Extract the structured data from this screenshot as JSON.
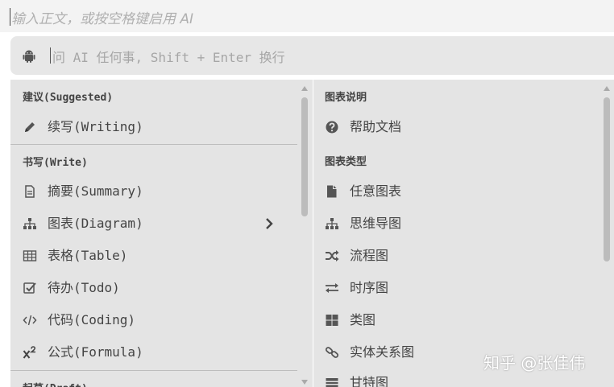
{
  "editor": {
    "placeholder": "输入正文，或按空格键启用 AI"
  },
  "ai_bar": {
    "placeholder": "问 AI 任何事, Shift + Enter 换行",
    "icon": "android-icon"
  },
  "left_menu": {
    "sections": [
      {
        "header": "建议(Suggested)",
        "items": [
          {
            "label": "续写(Writing)",
            "icon": "pencil-icon"
          }
        ]
      },
      {
        "header": "书写(Write)",
        "items": [
          {
            "label": "摘要(Summary)",
            "icon": "document-icon"
          },
          {
            "label": "图表(Diagram)",
            "icon": "sitemap-icon",
            "has_submenu": true
          },
          {
            "label": "表格(Table)",
            "icon": "table-icon"
          },
          {
            "label": "待办(Todo)",
            "icon": "checkbox-icon"
          },
          {
            "label": "代码(Coding)",
            "icon": "code-icon"
          },
          {
            "label": "公式(Formula)",
            "icon": "superscript-icon"
          }
        ]
      },
      {
        "header": "起草(Draft)",
        "items": []
      }
    ]
  },
  "right_menu": {
    "sections": [
      {
        "header": "图表说明",
        "items": [
          {
            "label": "帮助文档",
            "icon": "help-icon"
          }
        ]
      },
      {
        "header": "图表类型",
        "items": [
          {
            "label": "任意图表",
            "icon": "file-icon"
          },
          {
            "label": "思维导图",
            "icon": "sitemap-icon"
          },
          {
            "label": "流程图",
            "icon": "shuffle-icon"
          },
          {
            "label": "时序图",
            "icon": "exchange-icon"
          },
          {
            "label": "类图",
            "icon": "grid-icon"
          },
          {
            "label": "实体关系图",
            "icon": "link-icon"
          },
          {
            "label": "甘特图",
            "icon": "gantt-icon"
          }
        ]
      }
    ]
  },
  "watermark": "知乎 @张佳伟",
  "colors": {
    "panel_bg": "#e4e4e4",
    "ai_bar_bg": "#e7e7e7",
    "text": "#444444",
    "scrollbar": "#bcbcbc"
  }
}
